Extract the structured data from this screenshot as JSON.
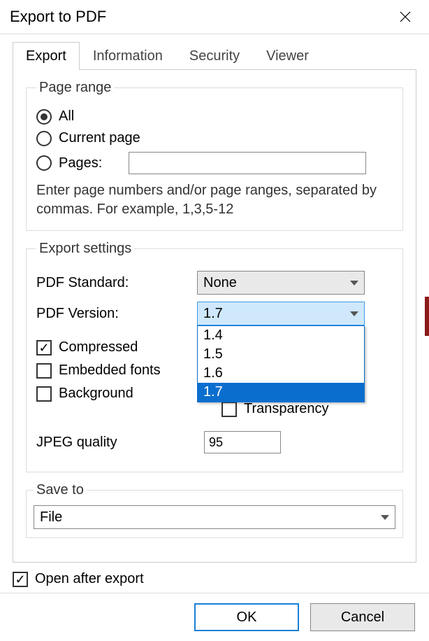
{
  "window": {
    "title": "Export to PDF"
  },
  "tabs": [
    "Export",
    "Information",
    "Security",
    "Viewer"
  ],
  "active_tab": 0,
  "page_range": {
    "legend": "Page range",
    "options": {
      "all": "All",
      "current": "Current page",
      "pages": "Pages:"
    },
    "selected": "all",
    "pages_value": "",
    "hint": "Enter page numbers and/or page ranges, separated by commas. For example, 1,3,5-12"
  },
  "export_settings": {
    "legend": "Export settings",
    "pdf_standard": {
      "label": "PDF Standard:",
      "value": "None"
    },
    "pdf_version": {
      "label": "PDF Version:",
      "value": "1.7",
      "options": [
        "1.4",
        "1.5",
        "1.6",
        "1.7"
      ],
      "open": true
    },
    "compressed": {
      "label": "Compressed",
      "checked": true
    },
    "embedded_fonts": {
      "label": "Embedded fonts",
      "checked": false
    },
    "background": {
      "label": "Background",
      "checked": false
    },
    "transparency": {
      "label": "Transparency",
      "checked": false
    },
    "jpeg_quality": {
      "label": "JPEG quality",
      "value": "95"
    }
  },
  "save_to": {
    "legend": "Save to",
    "value": "File"
  },
  "open_after_export": {
    "label": "Open after export",
    "checked": true
  },
  "buttons": {
    "ok": "OK",
    "cancel": "Cancel"
  }
}
